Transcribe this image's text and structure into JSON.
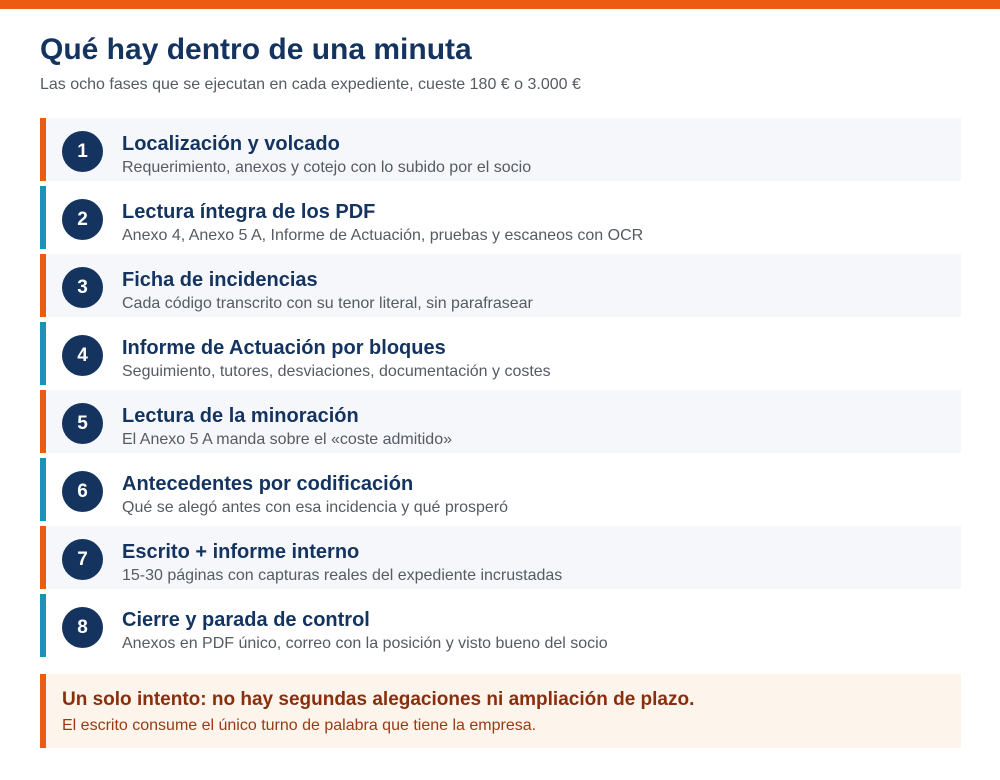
{
  "header": {
    "title": "Qué hay dentro de una minuta",
    "subtitle": "Las ocho fases que se ejecutan en cada expediente, cueste 180 € o 3.000 €"
  },
  "phases": [
    {
      "number": "1",
      "title": "Localización y volcado",
      "description": "Requerimiento, anexos y cotejo con lo subido por el socio"
    },
    {
      "number": "2",
      "title": "Lectura íntegra de los PDF",
      "description": "Anexo 4, Anexo 5 A, Informe de Actuación, pruebas y escaneos con OCR"
    },
    {
      "number": "3",
      "title": "Ficha de incidencias",
      "description": "Cada código transcrito con su tenor literal, sin parafrasear"
    },
    {
      "number": "4",
      "title": "Informe de Actuación por bloques",
      "description": "Seguimiento, tutores, desviaciones, documentación y costes"
    },
    {
      "number": "5",
      "title": "Lectura de la minoración",
      "description": "El Anexo 5 A manda sobre el «coste admitido»"
    },
    {
      "number": "6",
      "title": "Antecedentes por codificación",
      "description": "Qué se alegó antes con esa incidencia y qué prosperó"
    },
    {
      "number": "7",
      "title": "Escrito + informe interno",
      "description": "15-30 páginas con capturas reales del expediente incrustadas"
    },
    {
      "number": "8",
      "title": "Cierre y parada de control",
      "description": "Anexos en PDF único, correo con la posición y visto bueno del socio"
    }
  ],
  "callout": {
    "title": "Un solo intento: no hay segundas alegaciones ni ampliación de plazo.",
    "text": "El escrito consume el único turno de palabra que tiene la empresa."
  },
  "colors": {
    "accent_orange": "#ec5b12",
    "accent_teal": "#1d93b4",
    "navy": "#14335f",
    "callout_bg": "#fdf4ec"
  }
}
